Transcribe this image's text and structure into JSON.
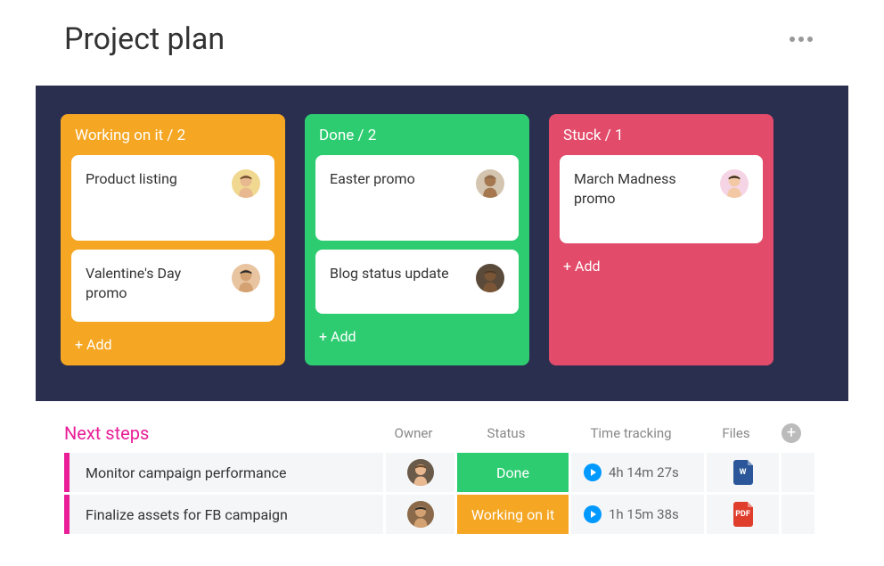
{
  "header": {
    "title": "Project plan"
  },
  "kanban": {
    "columns": [
      {
        "color": "yellow",
        "header_text": "Working on it / 2",
        "status": "Working on it",
        "count": 2,
        "cards": [
          {
            "title": "Product listing",
            "avatar_bg": "#f0d890",
            "avatar_seed": 1
          },
          {
            "title": "Valentine's Day promo",
            "avatar_bg": "#e8c4a0",
            "avatar_seed": 2
          }
        ],
        "add_label": "+ Add"
      },
      {
        "color": "green",
        "header_text": "Done / 2",
        "status": "Done",
        "count": 2,
        "cards": [
          {
            "title": "Easter promo",
            "avatar_bg": "#d4c5b0",
            "avatar_seed": 3
          },
          {
            "title": "Blog status update",
            "avatar_bg": "#5a4a3a",
            "avatar_seed": 4
          }
        ],
        "add_label": "+ Add"
      },
      {
        "color": "red",
        "header_text": "Stuck / 1",
        "status": "Stuck",
        "count": 1,
        "cards": [
          {
            "title": "March Madness promo",
            "avatar_bg": "#f5d5e5",
            "avatar_seed": 5
          }
        ],
        "add_label": "+ Add"
      }
    ]
  },
  "table": {
    "group_title": "Next steps",
    "headers": {
      "owner": "Owner",
      "status": "Status",
      "time_tracking": "Time tracking",
      "files": "Files"
    },
    "rows": [
      {
        "name": "Monitor campaign performance",
        "owner_avatar_bg": "#6a5a4a",
        "owner_seed": 6,
        "status_label": "Done",
        "status_class": "done",
        "time": "4h 14m 27s",
        "file_type": "word",
        "file_label": "W"
      },
      {
        "name": "Finalize assets for FB campaign",
        "owner_avatar_bg": "#8a6a4a",
        "owner_seed": 7,
        "status_label": "Working on it",
        "status_class": "working",
        "time": "1h 15m 38s",
        "file_type": "pdf",
        "file_label": "PDF"
      }
    ]
  }
}
